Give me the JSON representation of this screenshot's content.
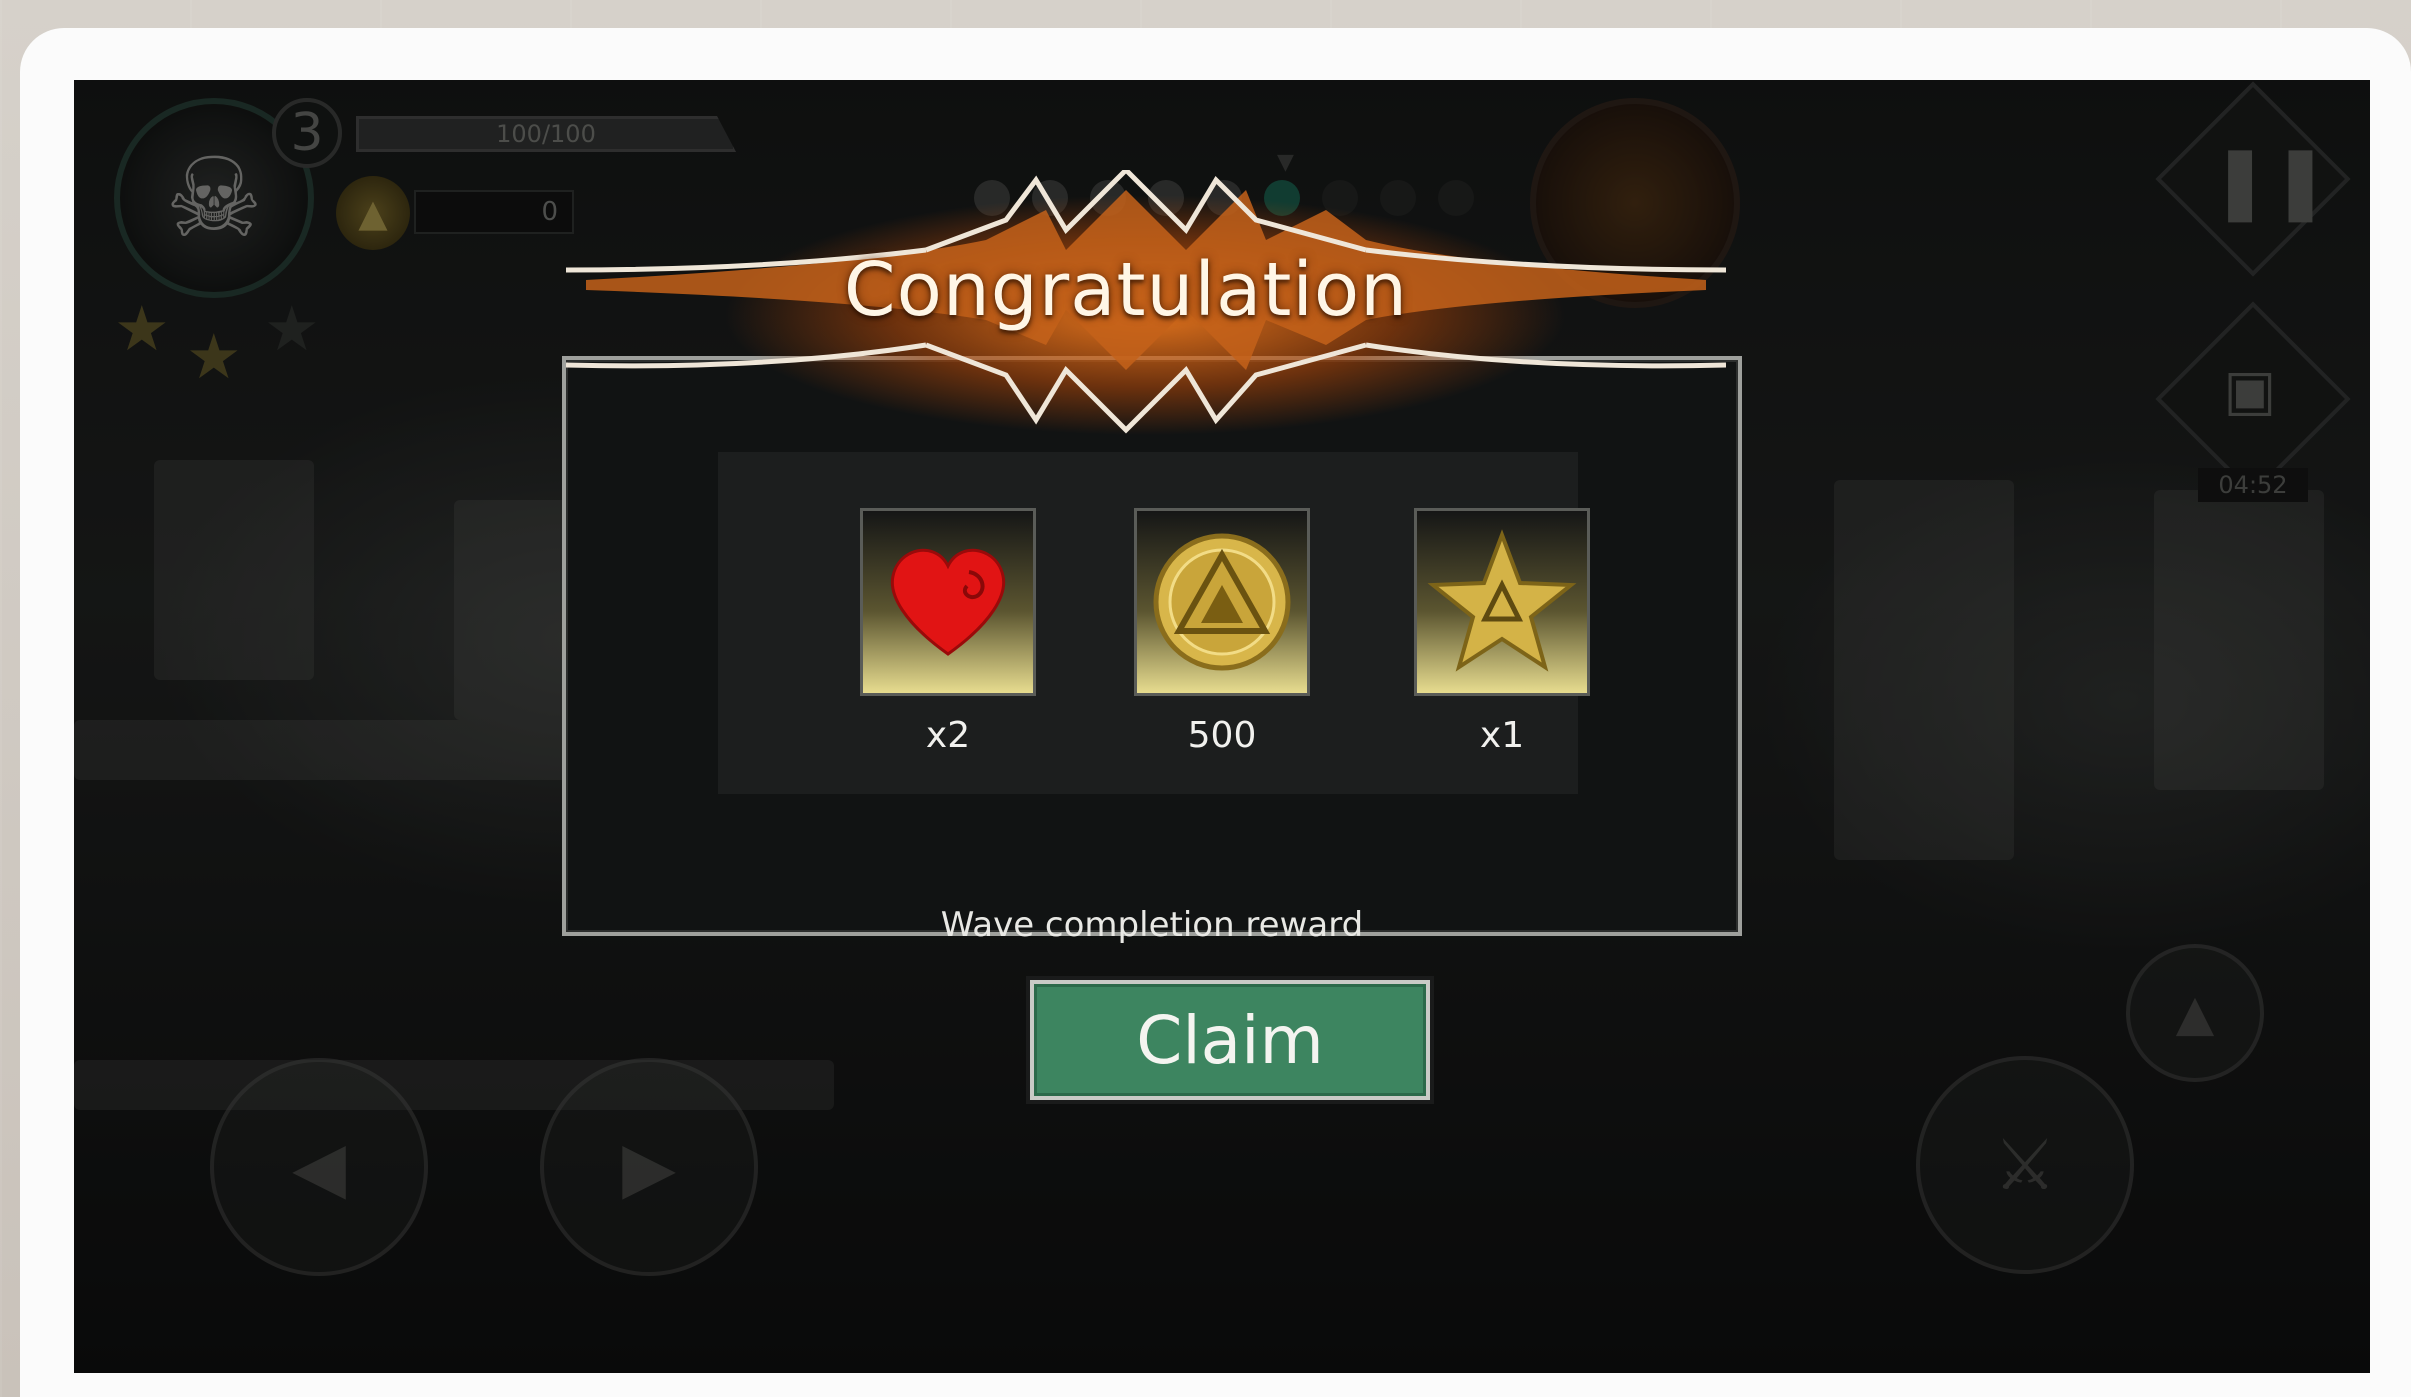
{
  "hud": {
    "player_level": "3",
    "xp_text": "100/100",
    "coins": "0",
    "timer": "04:52"
  },
  "dialog": {
    "title": "Congratulation",
    "rewards": [
      {
        "icon": "heart-icon",
        "quantity": "x2"
      },
      {
        "icon": "coin-icon",
        "quantity": "500"
      },
      {
        "icon": "star-icon",
        "quantity": "x1"
      }
    ],
    "caption": "Wave completion reward",
    "claim_label": "Claim"
  },
  "wave_progress": {
    "total": 9,
    "completed": 5,
    "current_index": 5
  },
  "colors": {
    "claim_button": "#3d8560",
    "banner_glow": "#eb781e",
    "reward_gold": "#e7dc8f",
    "heart_red": "#e11414"
  }
}
